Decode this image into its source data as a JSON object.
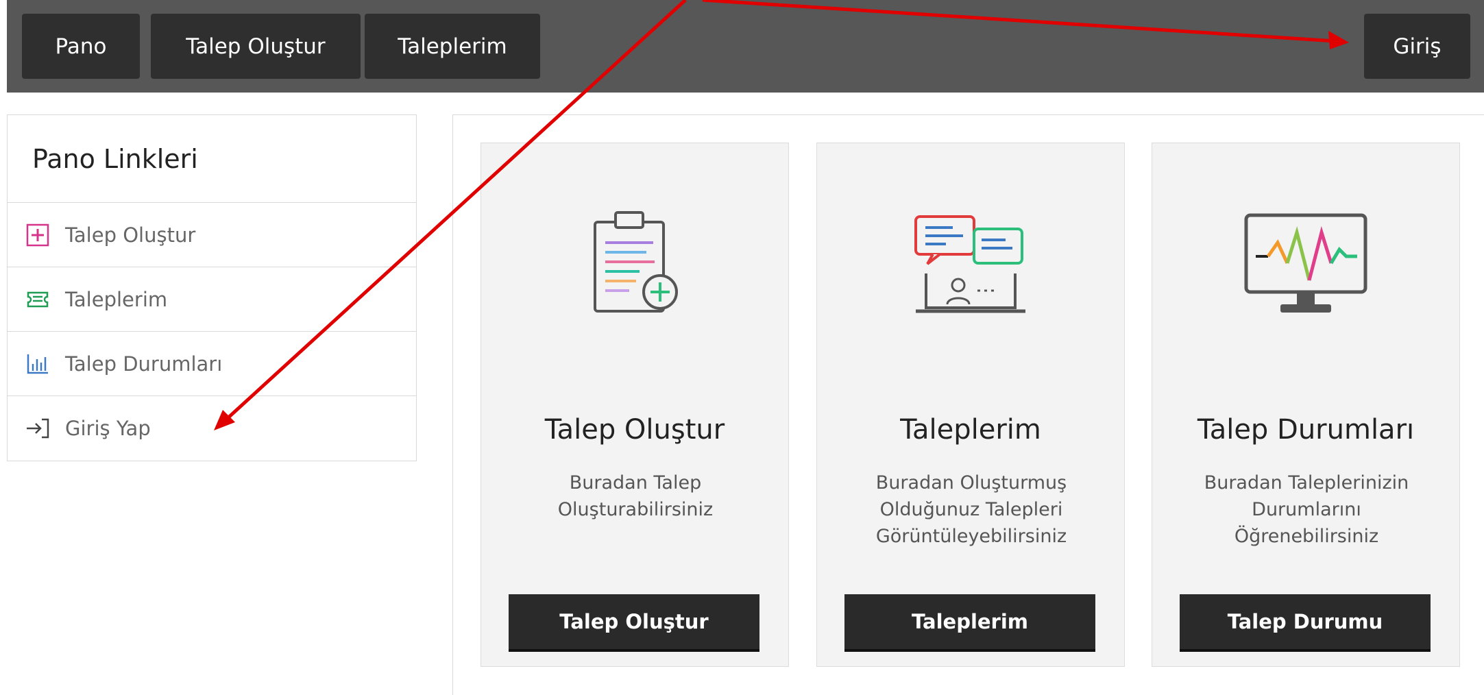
{
  "topnav": {
    "items": [
      {
        "label": "Pano"
      },
      {
        "label": "Talep Oluştur"
      },
      {
        "label": "Taleplerim"
      }
    ],
    "login_label": "Giriş"
  },
  "sidebar": {
    "title": "Pano Linkleri",
    "items": [
      {
        "label": "Talep Oluştur",
        "icon": "plus-square-icon"
      },
      {
        "label": "Taleplerim",
        "icon": "ticket-icon"
      },
      {
        "label": "Talep Durumları",
        "icon": "bar-chart-icon"
      },
      {
        "label": "Giriş Yap",
        "icon": "login-arrow-icon"
      }
    ]
  },
  "cards": [
    {
      "icon": "clipboard-plus-icon",
      "title": "Talep Oluştur",
      "desc": "Buradan Talep Oluşturabilirsiniz",
      "button": "Talep Oluştur"
    },
    {
      "icon": "chat-laptop-icon",
      "title": "Taleplerim",
      "desc": "Buradan Oluşturmuş Olduğunuz Talepleri Görüntüleyebilirsiniz",
      "button": "Taleplerim"
    },
    {
      "icon": "monitor-pulse-icon",
      "title": "Talep Durumları",
      "desc": "Buradan Taleplerinizin Durumlarını Öğrenebilirsiniz",
      "button": "Talep Durumu"
    }
  ],
  "colors": {
    "topbar": "#575757",
    "button_dark": "#2a2a2a",
    "annotation_arrow": "#e00000"
  }
}
